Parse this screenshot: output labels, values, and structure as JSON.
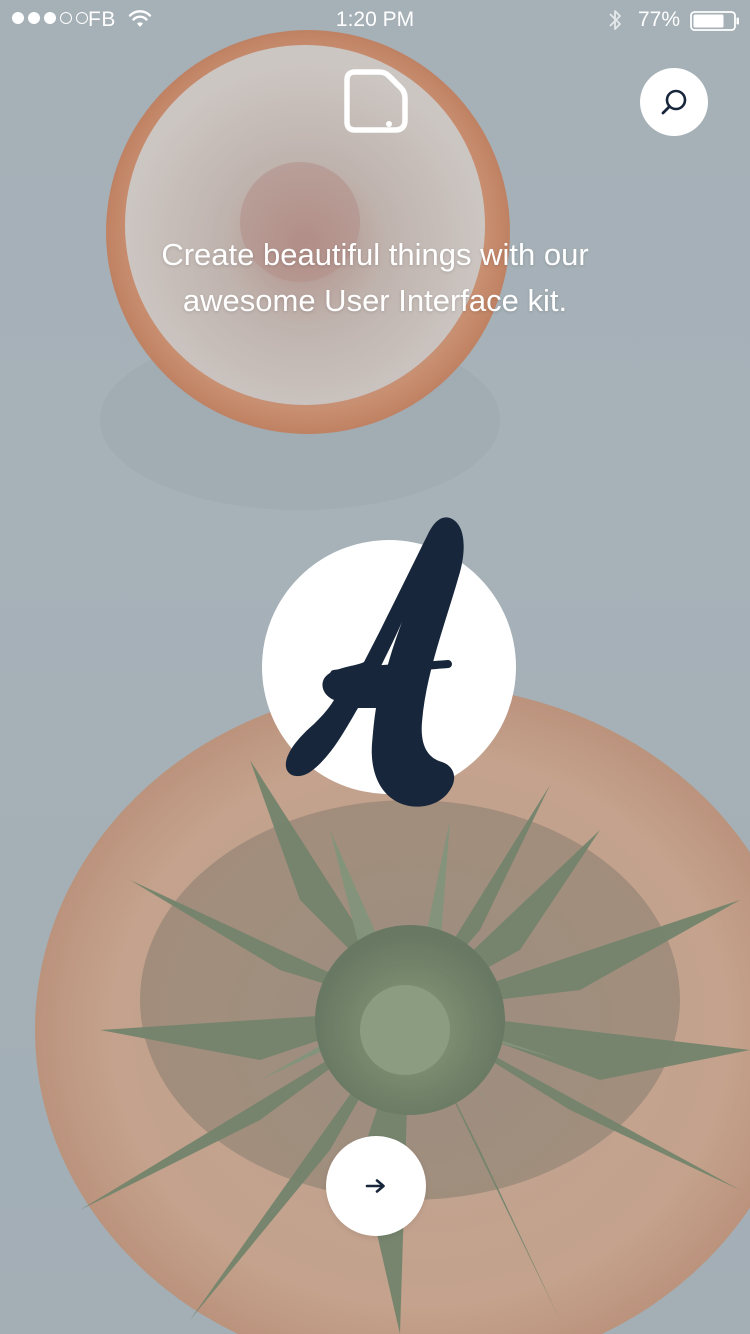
{
  "status_bar": {
    "carrier": "FB",
    "time": "1:20 PM",
    "battery_percent": "77%",
    "battery_level": 0.77,
    "signal_bars_filled": 3,
    "signal_bars_total": 5
  },
  "onboarding": {
    "tagline": "Create beautiful things with our awesome User Interface kit."
  },
  "icons": {
    "logo": "document-corner-icon",
    "search": "search-icon",
    "brand": "letter-a-brush-mark",
    "next": "arrow-right-icon"
  },
  "colors": {
    "background": "#a9b3b9",
    "button_bg": "#ffffff",
    "brand_ink": "#17263a",
    "text": "#ffffff"
  }
}
